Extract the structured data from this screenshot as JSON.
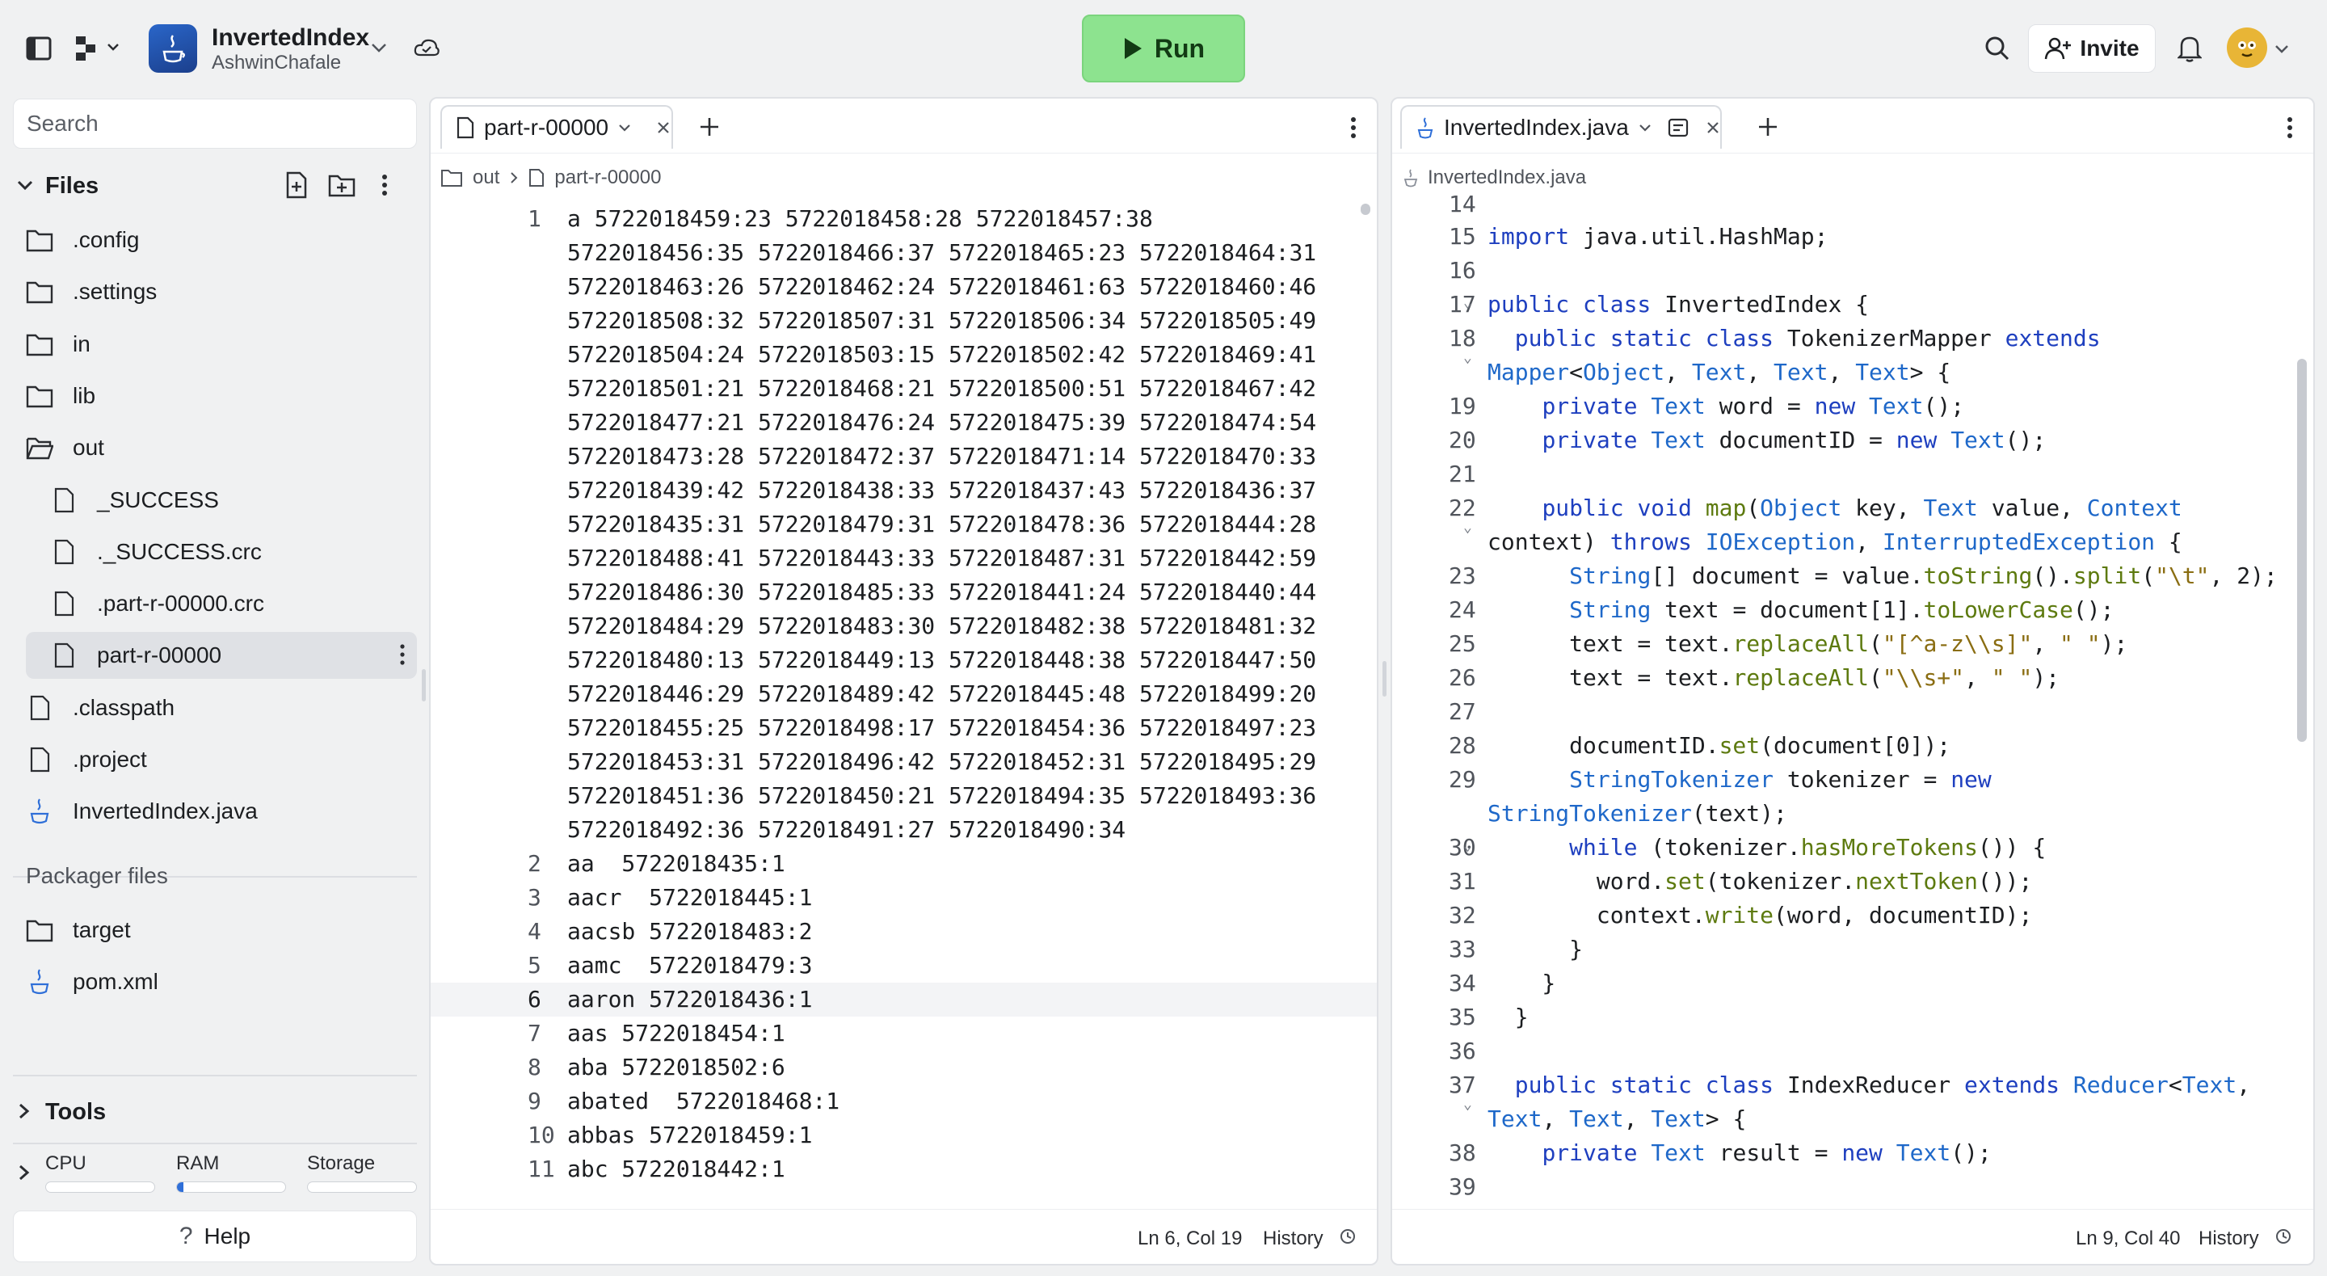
{
  "app": {
    "name": "InvertedIndex",
    "owner": "AshwinChafale",
    "run_label": "Run",
    "invite_label": "Invite"
  },
  "sidebar": {
    "search_placeholder": "Search",
    "files_label": "Files",
    "tree": [
      {
        "name": ".config",
        "type": "folder",
        "depth": 0
      },
      {
        "name": ".settings",
        "type": "folder",
        "depth": 0
      },
      {
        "name": "in",
        "type": "folder",
        "depth": 0
      },
      {
        "name": "lib",
        "type": "folder",
        "depth": 0
      },
      {
        "name": "out",
        "type": "folder-open",
        "depth": 0
      },
      {
        "name": "_SUCCESS",
        "type": "file",
        "depth": 1
      },
      {
        "name": "._SUCCESS.crc",
        "type": "file",
        "depth": 1
      },
      {
        "name": ".part-r-00000.crc",
        "type": "file",
        "depth": 1
      },
      {
        "name": "part-r-00000",
        "type": "file",
        "depth": 1,
        "selected": true
      },
      {
        "name": ".classpath",
        "type": "file",
        "depth": 0
      },
      {
        "name": ".project",
        "type": "file",
        "depth": 0
      },
      {
        "name": "InvertedIndex.java",
        "type": "java",
        "depth": 0
      }
    ],
    "packager_label": "Packager files",
    "packager_tree": [
      {
        "name": "target",
        "type": "folder"
      },
      {
        "name": "pom.xml",
        "type": "java"
      }
    ],
    "tools_label": "Tools",
    "resources": [
      {
        "label": "CPU",
        "fraction": 0.0
      },
      {
        "label": "RAM",
        "fraction": 0.06
      },
      {
        "label": "Storage",
        "fraction": 0.0
      }
    ],
    "help_label": "Help"
  },
  "left_pane": {
    "tab_label": "part-r-00000",
    "breadcrumb": [
      "out",
      "part-r-00000"
    ],
    "lines": [
      {
        "n": "1",
        "text": "a 5722018459:23 5722018458:28 5722018457:38"
      },
      {
        "n": "",
        "text": "5722018456:35 5722018466:37 5722018465:23 5722018464:31"
      },
      {
        "n": "",
        "text": "5722018463:26 5722018462:24 5722018461:63 5722018460:46"
      },
      {
        "n": "",
        "text": "5722018508:32 5722018507:31 5722018506:34 5722018505:49"
      },
      {
        "n": "",
        "text": "5722018504:24 5722018503:15 5722018502:42 5722018469:41"
      },
      {
        "n": "",
        "text": "5722018501:21 5722018468:21 5722018500:51 5722018467:42"
      },
      {
        "n": "",
        "text": "5722018477:21 5722018476:24 5722018475:39 5722018474:54"
      },
      {
        "n": "",
        "text": "5722018473:28 5722018472:37 5722018471:14 5722018470:33"
      },
      {
        "n": "",
        "text": "5722018439:42 5722018438:33 5722018437:43 5722018436:37"
      },
      {
        "n": "",
        "text": "5722018435:31 5722018479:31 5722018478:36 5722018444:28"
      },
      {
        "n": "",
        "text": "5722018488:41 5722018443:33 5722018487:31 5722018442:59"
      },
      {
        "n": "",
        "text": "5722018486:30 5722018485:33 5722018441:24 5722018440:44"
      },
      {
        "n": "",
        "text": "5722018484:29 5722018483:30 5722018482:38 5722018481:32"
      },
      {
        "n": "",
        "text": "5722018480:13 5722018449:13 5722018448:38 5722018447:50"
      },
      {
        "n": "",
        "text": "5722018446:29 5722018489:42 5722018445:48 5722018499:20"
      },
      {
        "n": "",
        "text": "5722018455:25 5722018498:17 5722018454:36 5722018497:23"
      },
      {
        "n": "",
        "text": "5722018453:31 5722018496:42 5722018452:31 5722018495:29"
      },
      {
        "n": "",
        "text": "5722018451:36 5722018450:21 5722018494:35 5722018493:36"
      },
      {
        "n": "",
        "text": "5722018492:36 5722018491:27 5722018490:34"
      },
      {
        "n": "2",
        "text": "aa  5722018435:1"
      },
      {
        "n": "3",
        "text": "aacr  5722018445:1"
      },
      {
        "n": "4",
        "text": "aacsb 5722018483:2"
      },
      {
        "n": "5",
        "text": "aamc  5722018479:3"
      },
      {
        "n": "6",
        "text": "aaron 5722018436:1",
        "active": true
      },
      {
        "n": "7",
        "text": "aas 5722018454:1"
      },
      {
        "n": "8",
        "text": "aba 5722018502:6"
      },
      {
        "n": "9",
        "text": "abated  5722018468:1"
      },
      {
        "n": "10",
        "text": "abbas 5722018459:1"
      },
      {
        "n": "11",
        "text": "abc 5722018442:1"
      }
    ],
    "cursor": "Ln 6, Col 19",
    "history_label": "History"
  },
  "right_pane": {
    "tab_label": "InvertedIndex.java",
    "breadcrumb": [
      "InvertedIndex.java"
    ],
    "cursor": "Ln 9, Col 40",
    "history_label": "History"
  },
  "colors": {
    "run": "#8de38f",
    "keyword": "#1e3fbf",
    "type": "#1e68c9",
    "method": "#5d7a0f",
    "string": "#8a6d12"
  }
}
